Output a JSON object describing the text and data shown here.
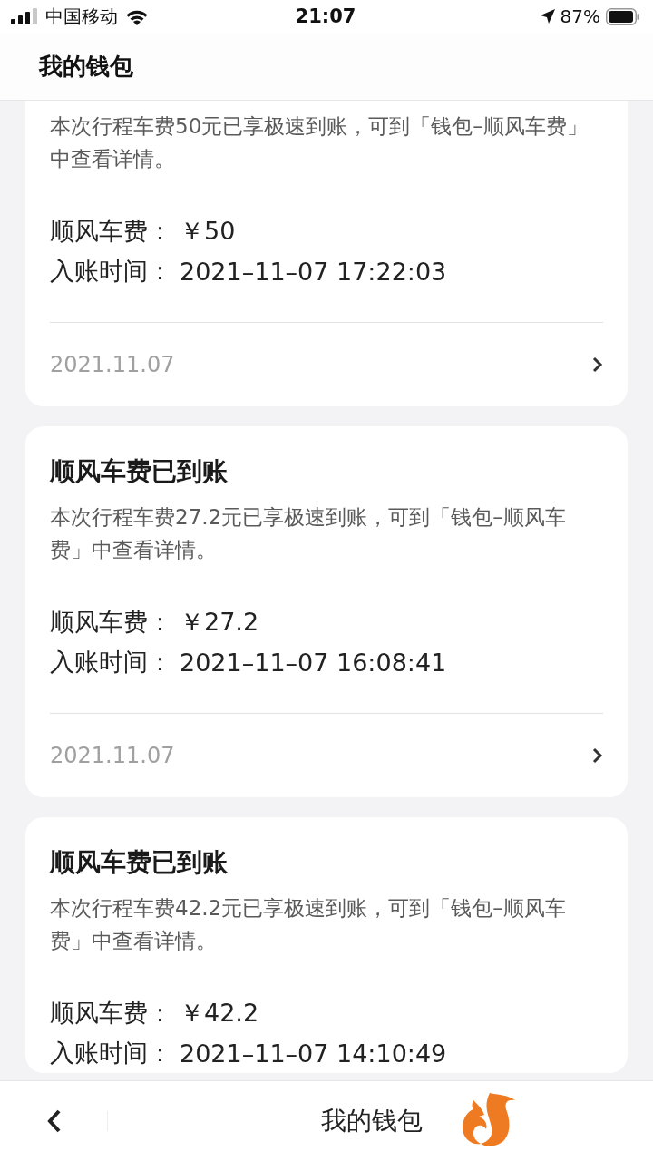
{
  "status_bar": {
    "carrier": "中国移动",
    "time": "21:07",
    "battery": "87%"
  },
  "header": {
    "title": "我的钱包"
  },
  "cards": [
    {
      "description": "本次行程车费50元已享极速到账，可到「钱包–顺风车费」中查看详情。",
      "fee_label": "顺风车费：",
      "fee_value": "￥50",
      "time_label": "入账时间：",
      "time_value": "2021–11–07 17:22:03",
      "date": "2021.11.07"
    },
    {
      "title": "顺风车费已到账",
      "description": "本次行程车费27.2元已享极速到账，可到「钱包–顺风车费」中查看详情。",
      "fee_label": "顺风车费：",
      "fee_value": "￥27.2",
      "time_label": "入账时间：",
      "time_value": "2021–11–07 16:08:41",
      "date": "2021.11.07"
    },
    {
      "title": "顺风车费已到账",
      "description": "本次行程车费42.2元已享极速到账，可到「钱包–顺风车费」中查看详情。",
      "fee_label": "顺风车费：",
      "fee_value": "￥42.2",
      "time_label": "入账时间：",
      "time_value": "2021–11–07 14:10:49"
    }
  ],
  "bottom_bar": {
    "title": "我的钱包"
  }
}
